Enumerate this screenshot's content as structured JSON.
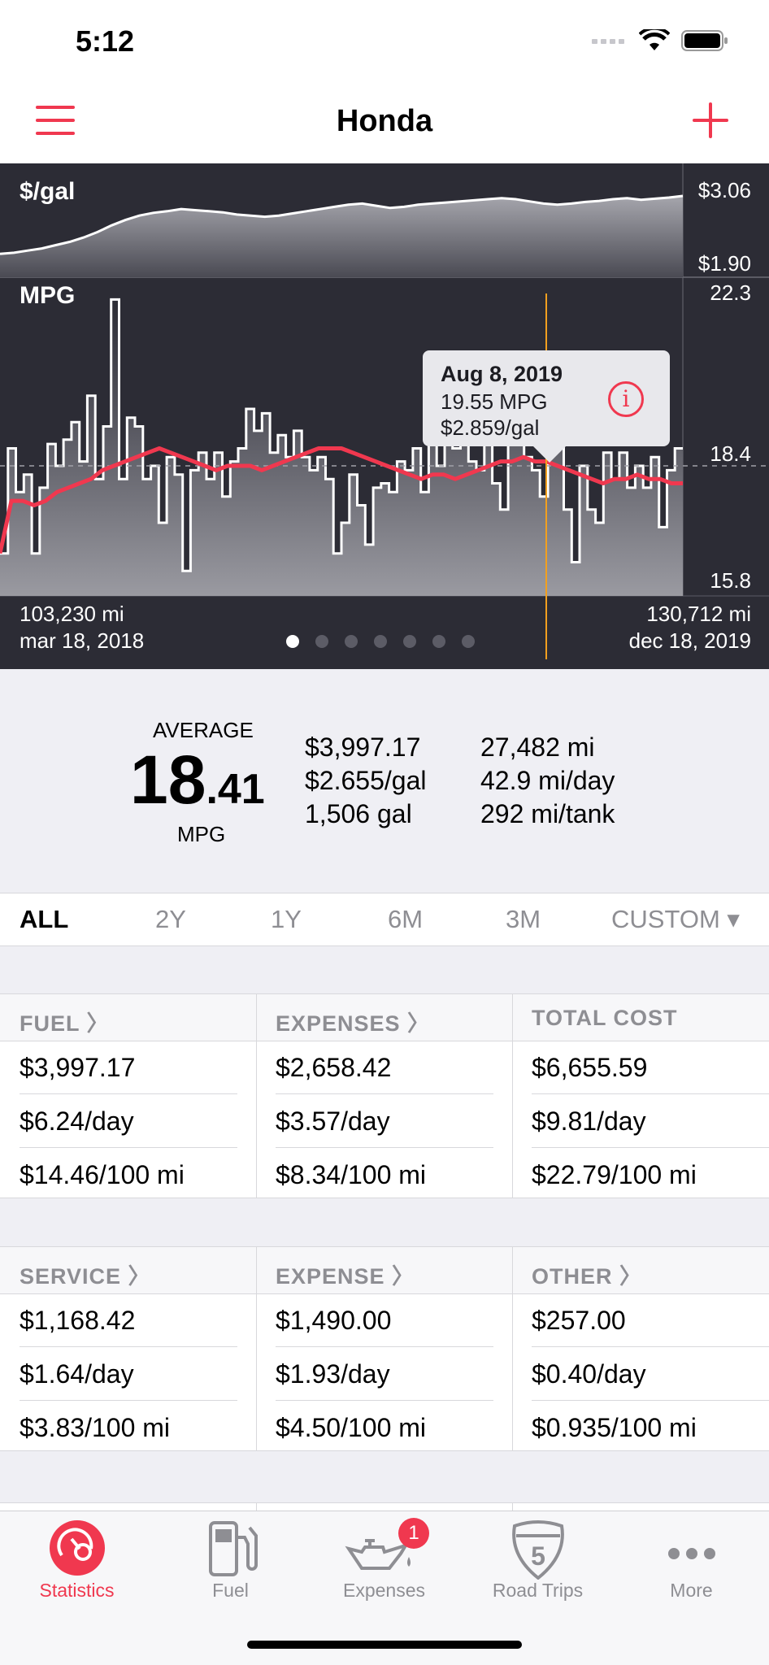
{
  "status": {
    "time": "5:12"
  },
  "nav": {
    "title": "Honda"
  },
  "chart": {
    "price_label": "$/gal",
    "mpg_label": "MPG",
    "price_max": "$3.06",
    "price_min": "$1.90",
    "mpg_max": "22.3",
    "mpg_mid": "18.4",
    "mpg_min": "15.8",
    "start_odometer": "103,230 mi",
    "start_date": "mar 18, 2018",
    "end_odometer": "130,712 mi",
    "end_date": "dec 18, 2019",
    "accent_color": "#f0384f",
    "cursor_color": "#f2a01f"
  },
  "chart_data": {
    "type": "line",
    "x_range": [
      "mar 18, 2018",
      "dec 18, 2019"
    ],
    "price_series": {
      "name": "$/gal",
      "ylim": [
        1.9,
        3.06
      ],
      "values": [
        2.0,
        2.02,
        2.06,
        2.1,
        2.16,
        2.22,
        2.3,
        2.4,
        2.52,
        2.62,
        2.7,
        2.75,
        2.78,
        2.82,
        2.8,
        2.78,
        2.76,
        2.72,
        2.7,
        2.68,
        2.7,
        2.74,
        2.78,
        2.82,
        2.86,
        2.9,
        2.92,
        2.88,
        2.84,
        2.86,
        2.9,
        2.92,
        2.94,
        2.96,
        2.98,
        3.0,
        3.02,
        3.0,
        2.96,
        2.92,
        2.9,
        2.92,
        2.95,
        2.97,
        3.0,
        3.02,
        2.99,
        3.01,
        3.03,
        3.06
      ]
    },
    "mpg_series": {
      "name": "MPG",
      "ylim": [
        15.8,
        22.3
      ],
      "values": [
        16.4,
        18.8,
        17.8,
        18.2,
        16.4,
        17.9,
        18.9,
        18.4,
        19.0,
        19.4,
        18.5,
        20.0,
        18.1,
        19.3,
        22.2,
        18.1,
        19.5,
        19.3,
        18.1,
        18.4,
        17.1,
        18.6,
        18.2,
        16.0,
        18.3,
        18.7,
        18.1,
        18.7,
        17.7,
        18.5,
        18.8,
        19.7,
        19.2,
        19.6,
        18.7,
        19.1,
        18.6,
        19.2,
        18.6,
        18.3,
        18.6,
        18.1,
        16.4,
        17.1,
        18.2,
        17.5,
        16.6,
        17.9,
        18.0,
        17.8,
        18.5,
        18.3,
        18.8,
        17.8,
        19.1,
        18.4,
        19.2,
        18.8,
        19.3,
        18.5,
        18.3,
        19.0,
        18.0,
        17.4,
        19.6,
        19.0,
        18.6,
        18.3,
        17.7,
        18.8,
        19.2,
        17.4,
        16.2,
        18.4,
        17.4,
        17.1,
        18.7,
        18.1,
        18.7,
        17.9,
        18.4,
        17.9,
        18.6,
        17.0,
        18.3,
        18.8
      ]
    },
    "mpg_average_line": {
      "name": "MPG average",
      "values": [
        16.4,
        17.6,
        17.6,
        17.5,
        17.6,
        17.8,
        17.9,
        18.0,
        18.1,
        18.3,
        18.4,
        18.5,
        18.6,
        18.7,
        18.8,
        18.7,
        18.6,
        18.5,
        18.4,
        18.3,
        18.4,
        18.4,
        18.4,
        18.3,
        18.4,
        18.5,
        18.6,
        18.7,
        18.8,
        18.8,
        18.8,
        18.7,
        18.6,
        18.5,
        18.4,
        18.3,
        18.2,
        18.1,
        18.2,
        18.2,
        18.1,
        18.2,
        18.3,
        18.4,
        18.5,
        18.5,
        18.6,
        18.5,
        18.5,
        18.4,
        18.3,
        18.2,
        18.1,
        18.0,
        18.1,
        18.1,
        18.2,
        18.1,
        18.1,
        18.0,
        18.0
      ]
    },
    "selected_point": {
      "date": "Aug 8, 2019",
      "mpg": 19.55,
      "price": 2.859,
      "position_fraction": 0.8
    },
    "reference_line": 18.4
  },
  "tooltip": {
    "date": "Aug 8, 2019",
    "mpg": "19.55 MPG",
    "price": "$2.859/gal"
  },
  "pagination": {
    "count": 7,
    "active": 0
  },
  "summary": {
    "average_label": "AVERAGE",
    "average_int": "18",
    "average_dec": ".41",
    "average_unit": "MPG",
    "total_fuel_cost": "$3,997.17",
    "avg_price": "$2.655/gal",
    "total_gallons": "1,506 gal",
    "distance": "27,482 mi",
    "per_day": "42.9 mi/day",
    "per_tank": "292 mi/tank"
  },
  "ranges": [
    "ALL",
    "2Y",
    "1Y",
    "6M",
    "3M",
    "CUSTOM ▾"
  ],
  "costs": {
    "fuel": {
      "header": "FUEL 〉",
      "total": "$3,997.17",
      "per_day": "$6.24/day",
      "per_100": "$14.46/100 mi"
    },
    "expenses": {
      "header": "EXPENSES 〉",
      "total": "$2,658.42",
      "per_day": "$3.57/day",
      "per_100": "$8.34/100 mi"
    },
    "total_cost": {
      "header": "TOTAL COST",
      "total": "$6,655.59",
      "per_day": "$9.81/day",
      "per_100": "$22.79/100 mi"
    }
  },
  "breakdown": {
    "service": {
      "header": "SERVICE 〉",
      "total": "$1,168.42",
      "per_day": "$1.64/day",
      "per_100": "$3.83/100 mi"
    },
    "expense": {
      "header": "EXPENSE 〉",
      "total": "$1,490.00",
      "per_day": "$1.93/day",
      "per_100": "$4.50/100 mi"
    },
    "other": {
      "header": "OTHER 〉",
      "total": "$257.00",
      "per_day": "$0.40/day",
      "per_100": "$0.935/100 mi"
    }
  },
  "tabs": {
    "statistics": "Statistics",
    "fuel": "Fuel",
    "expenses": "Expenses",
    "expenses_badge": "1",
    "road_trips": "Road Trips",
    "road_trips_shield": "5",
    "more": "More"
  }
}
